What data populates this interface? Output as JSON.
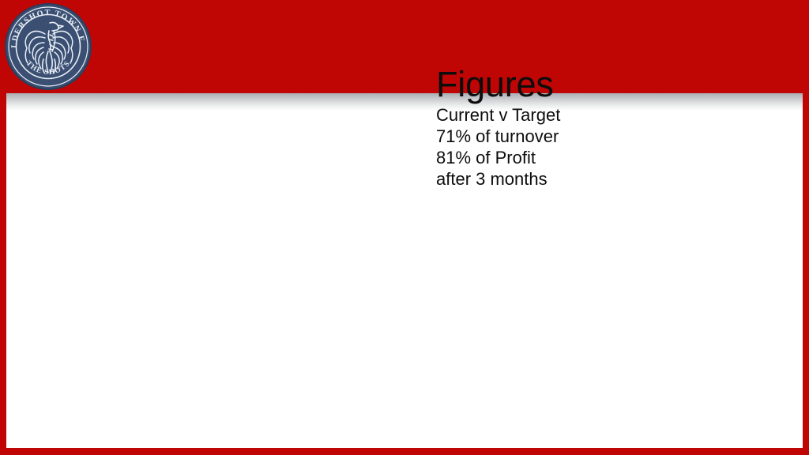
{
  "slide": {
    "theme": {
      "frame_red": "#c00505",
      "panel_white": "#ffffff",
      "crest_navy": "#3a4f72",
      "crest_line": "#e8eef6",
      "text_color": "#0d0d0d"
    },
    "header": {
      "logo": {
        "icon": "club-crest-icon",
        "alt": "Aldershot Town F.C. club crest",
        "ring_text_top": "ALDERSHOT TOWN F.C.",
        "ring_text_bottom": "THE SHOTS",
        "emblem": "phoenix-emblem"
      }
    },
    "body": {
      "title": "Figures",
      "lines": [
        "Current v Target",
        "71% of turnover",
        "81% of Profit",
        "after 3 months"
      ]
    }
  }
}
